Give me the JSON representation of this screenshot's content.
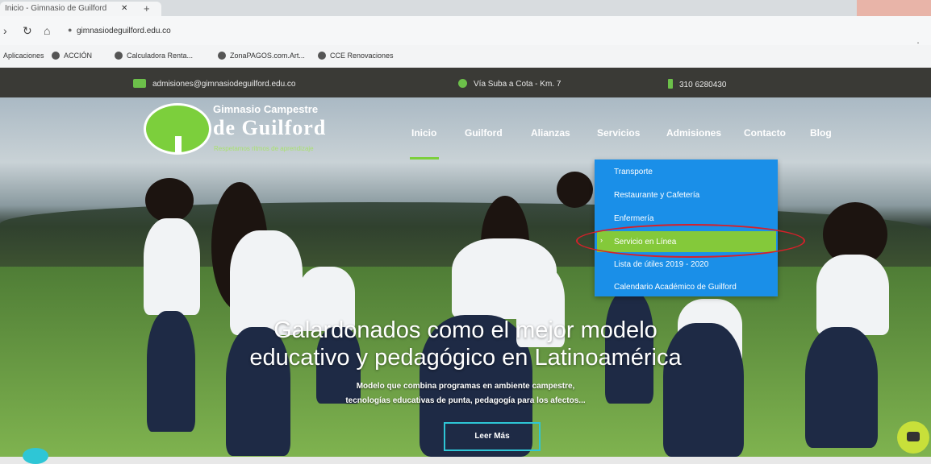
{
  "browser": {
    "tab_title": "Inicio - Gimnasio de Guilford",
    "tab_close": "✕",
    "new_tab": "+",
    "url": "gimnasiodeguilford.edu.co",
    "bookmarks": [
      "Aplicaciones",
      "ACCIÓN",
      "Calculadora Renta...",
      "ZonaPAGOS.com.Art...",
      "CCE Renovaciones"
    ]
  },
  "topbar": {
    "email": "admisiones@gimnasiodeguilford.edu.co",
    "address": "Vía Suba a Cota - Km. 7",
    "phone": "310 6280430"
  },
  "logo": {
    "line1": "Gimnasio Campestre",
    "line2": "de Guilford",
    "line3": "Respetamos ritmos de aprendizaje"
  },
  "nav": {
    "items": [
      "Inicio",
      "Guilford",
      "Alianzas",
      "Servicios",
      "Admisiones",
      "Contacto",
      "Blog"
    ]
  },
  "dropdown": {
    "items": [
      "Transporte",
      "Restaurante y Cafetería",
      "Enfermería",
      "Servicio en Línea",
      "Lista de útiles 2019 - 2020",
      "Calendario Académico de Guilford"
    ],
    "active_index": 3,
    "active_arrow": "›"
  },
  "hero": {
    "headline_1": "Galardonados como el mejor modelo",
    "headline_2": "educativo y pedagógico en Latinoamérica",
    "sub_1": "Modelo que combina programas en ambiente campestre,",
    "sub_2": "tecnologías educativas de punta, pedagogía para los afectos...",
    "button": "Leer Más"
  },
  "colors": {
    "accent_green": "#7ccf3c",
    "dropdown_blue": "#1a8fe8",
    "highlight_green": "#84c93a",
    "annotation_red": "#d6202a"
  }
}
